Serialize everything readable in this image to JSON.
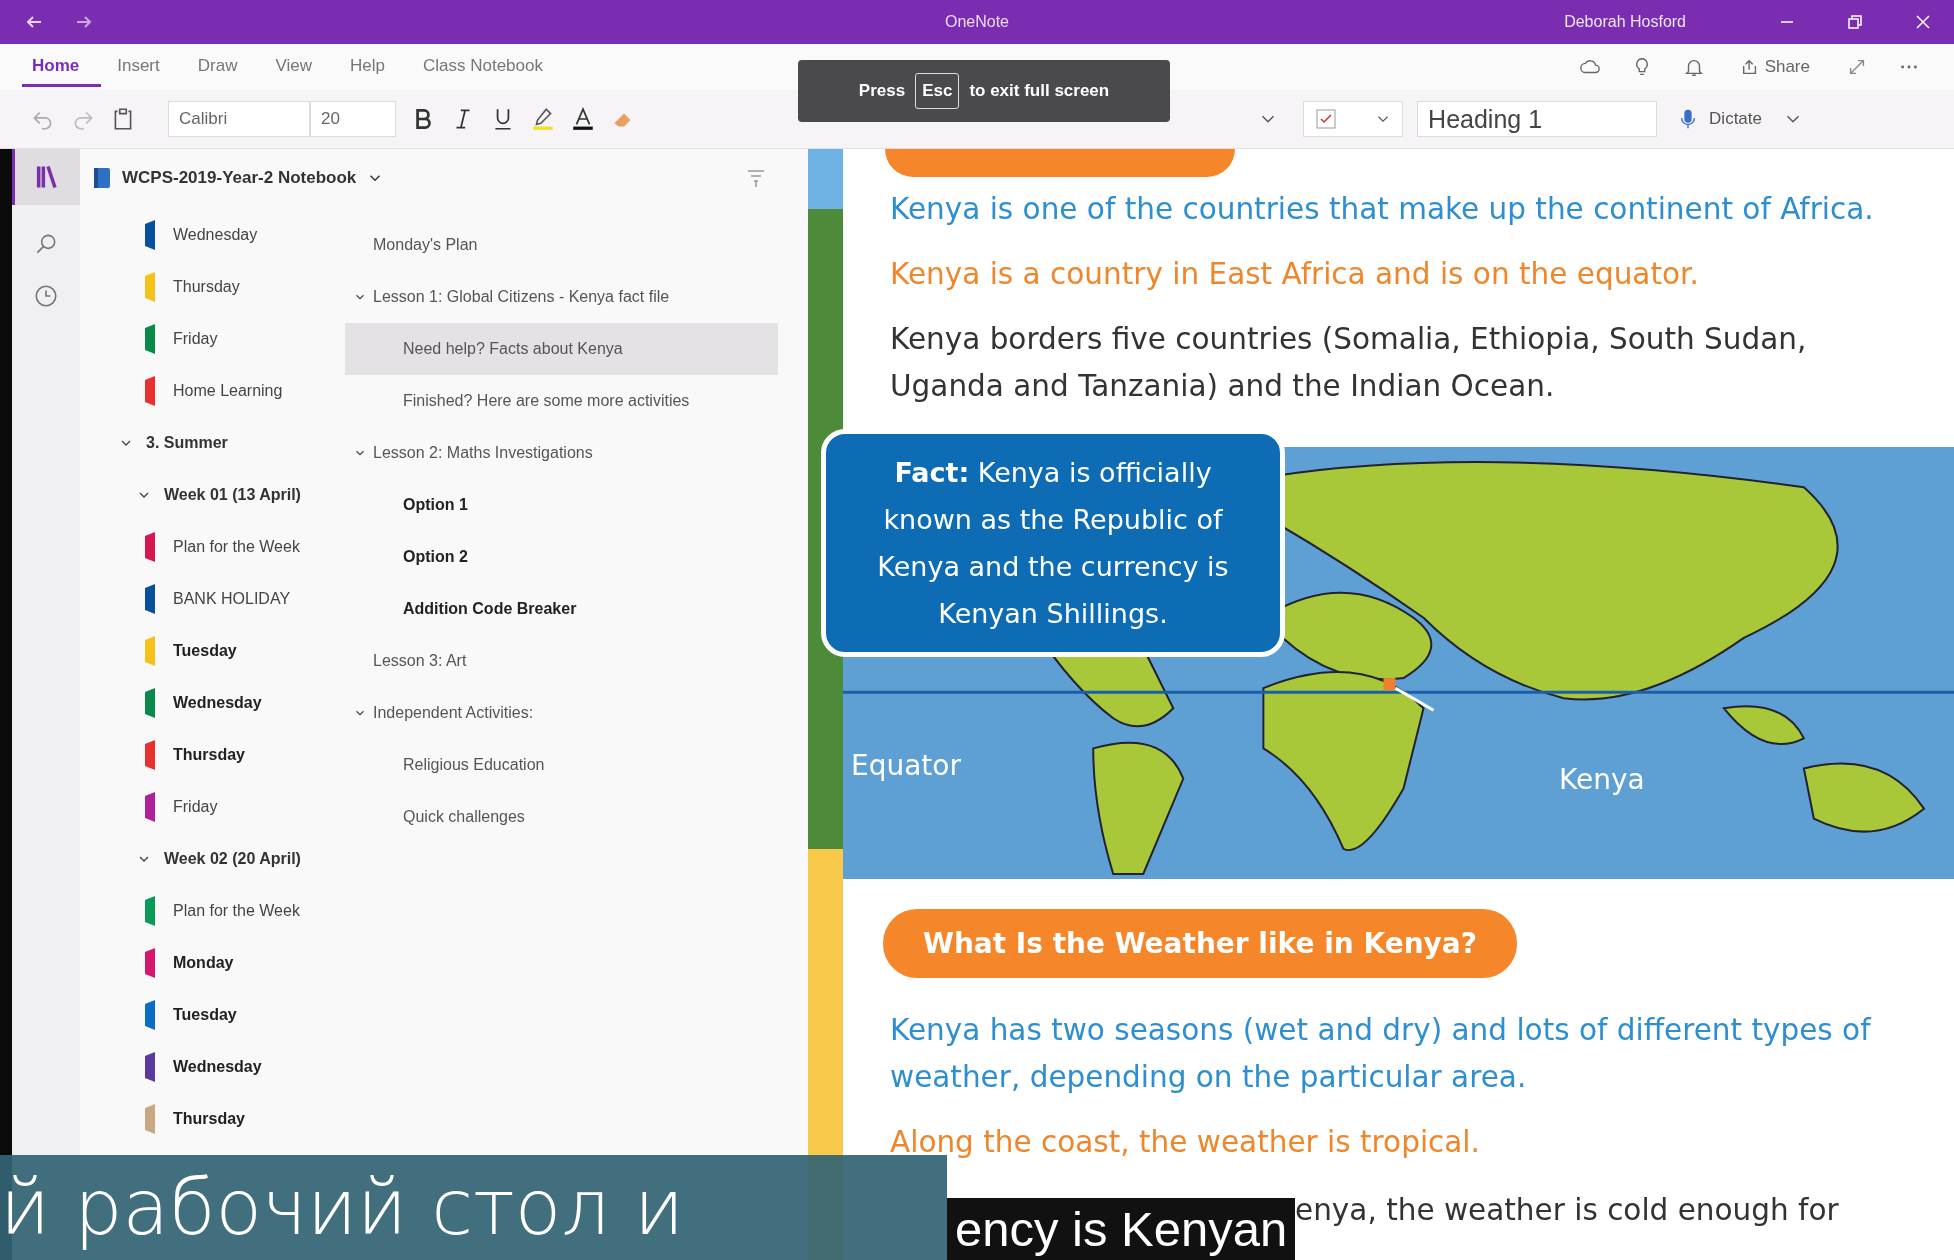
{
  "window": {
    "title": "OneNote",
    "user": "Deborah Hosford"
  },
  "ribbon": {
    "tabs": [
      {
        "label": "Home",
        "selected": true
      },
      {
        "label": "Insert",
        "selected": false
      },
      {
        "label": "Draw",
        "selected": false
      },
      {
        "label": "View",
        "selected": false
      },
      {
        "label": "Help",
        "selected": false
      },
      {
        "label": "Class Notebook",
        "selected": false
      }
    ],
    "share": "Share",
    "font": "Calibri",
    "size": "20",
    "style": "Heading 1",
    "dictate": "Dictate"
  },
  "toast": {
    "before": "Press",
    "key": "Esc",
    "after": "to exit full screen"
  },
  "notebook": {
    "name": "WCPS-2019-Year-2 Notebook"
  },
  "sections": [
    {
      "kind": "section",
      "name": "Wednesday",
      "color": "#0a4f9c",
      "unread": false
    },
    {
      "kind": "section",
      "name": "Thursday",
      "color": "#f5c21b",
      "unread": false
    },
    {
      "kind": "section",
      "name": "Friday",
      "color": "#0a8a4a",
      "unread": false
    },
    {
      "kind": "section",
      "name": "Home Learning",
      "color": "#e8312f",
      "unread": false
    },
    {
      "kind": "group",
      "name": "3. Summer",
      "expanded": true,
      "children": [
        {
          "kind": "group",
          "name": "Week 01 (13 April)",
          "expanded": true,
          "children": [
            {
              "kind": "section",
              "name": "Plan for the Week",
              "color": "#d4174f",
              "unread": false
            },
            {
              "kind": "section",
              "name": "BANK HOLIDAY",
              "color": "#0a4f9c",
              "unread": false
            },
            {
              "kind": "section",
              "name": "Tuesday",
              "color": "#f5c21b",
              "unread": true
            },
            {
              "kind": "section",
              "name": "Wednesday",
              "color": "#0a8a4a",
              "unread": true
            },
            {
              "kind": "section",
              "name": "Thursday",
              "color": "#e8312f",
              "unread": true
            },
            {
              "kind": "section",
              "name": "Friday",
              "color": "#b0209a",
              "unread": false
            }
          ]
        },
        {
          "kind": "group",
          "name": "Week 02 (20 April)",
          "expanded": true,
          "children": [
            {
              "kind": "section",
              "name": "Plan for the Week",
              "color": "#0a9a5a",
              "unread": false
            },
            {
              "kind": "section",
              "name": "Monday",
              "color": "#d4176f",
              "unread": true
            },
            {
              "kind": "section",
              "name": "Tuesday",
              "color": "#0a6ec4",
              "unread": true
            },
            {
              "kind": "section",
              "name": "Wednesday",
              "color": "#5a3a9a",
              "unread": true
            },
            {
              "kind": "section",
              "name": "Thursday",
              "color": "#c8a882",
              "unread": true
            }
          ]
        }
      ]
    }
  ],
  "pages": [
    {
      "title": "Monday's Plan",
      "selected": false,
      "unread": false
    },
    {
      "title": "Lesson 1: Global Citizens - Kenya fact file",
      "selected": false,
      "unread": false,
      "expanded": true,
      "children": [
        {
          "title": "Need help? Facts about Kenya",
          "selected": true,
          "unread": false
        },
        {
          "title": "Finished? Here are some more activities",
          "selected": false,
          "unread": false
        }
      ]
    },
    {
      "title": "Lesson 2: Maths Investigations",
      "selected": false,
      "unread": false,
      "expanded": true,
      "children": [
        {
          "title": "Option 1",
          "selected": false,
          "unread": true
        },
        {
          "title": "Option 2",
          "selected": false,
          "unread": true
        },
        {
          "title": "Addition Code Breaker",
          "selected": false,
          "unread": true
        }
      ]
    },
    {
      "title": "Lesson 3: Art",
      "selected": false,
      "unread": false
    },
    {
      "title": "Independent Activities:",
      "selected": false,
      "unread": false,
      "expanded": true,
      "children": [
        {
          "title": "Religious Education",
          "selected": false,
          "unread": false
        },
        {
          "title": "Quick challenges",
          "selected": false,
          "unread": false
        }
      ]
    }
  ],
  "content": {
    "intro": [
      {
        "text": "Kenya is one of the countries that make up the continent of Africa.",
        "color": "#2e8fd0"
      },
      {
        "text": "Kenya is a country in East Africa and is on the equator.",
        "color": "#f0862a"
      },
      {
        "text": "Kenya borders five countries (Somalia, Ethiopia, South Sudan, Uganda and Tanzania) and the Indian Ocean.",
        "color": "#333333"
      }
    ],
    "fact": "**Fact:** Kenya is officially known as the Republic of Kenya and the currency is Kenyan Shillings.",
    "map_labels": {
      "equator": "Equator",
      "kenya": "Kenya"
    },
    "heading": "What Is the Weather like in Kenya?",
    "weather": [
      {
        "text": "Kenya has two seasons (wet and dry) and lots of different types of weather, depending on the particular area.",
        "color": "#2e8fd0"
      },
      {
        "text": "Along the coast, the weather is tropical.",
        "color": "#f0862a"
      },
      {
        "text": "enya, the weather is cold enough for",
        "color": "#333333",
        "kind": "covered"
      }
    ]
  },
  "captions": {
    "translated": "й рабочий стол и",
    "original": "ency is Kenyan"
  }
}
